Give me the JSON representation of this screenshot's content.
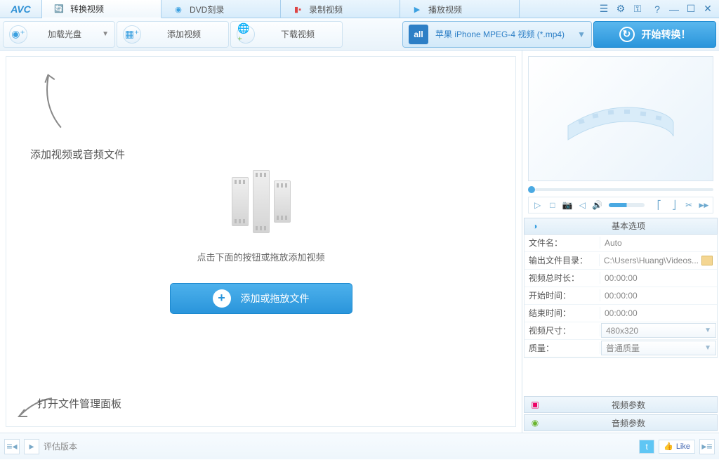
{
  "logo": "AVC",
  "tabs": [
    {
      "label": "转换视频",
      "icon": "🔄",
      "active": true
    },
    {
      "label": "DVD刻录",
      "icon": "◉",
      "active": false
    },
    {
      "label": "录制视频",
      "icon": "▮▪",
      "active": false
    },
    {
      "label": "播放视频",
      "icon": "▶",
      "active": false
    }
  ],
  "toolbar": {
    "load_disc": "加载光盘",
    "add_video": "添加视频",
    "download": "下载视频",
    "format": "苹果 iPhone MPEG-4 视频 (*.mp4)",
    "format_all": "all",
    "start": "开始转换！"
  },
  "hints": {
    "add_files": "添加视频或音频文件",
    "open_panel": "打开文件管理面板",
    "drop_text": "点击下面的按钮或拖放添加视频",
    "add_button": "添加或拖放文件"
  },
  "panels": {
    "basic": "基本选项",
    "video": "视频参数",
    "audio": "音频参数"
  },
  "props": {
    "filename_k": "文件名：",
    "filename_v": "Auto",
    "outdir_k": "输出文件目录：",
    "outdir_v": "C:\\Users\\Huang\\Videos...",
    "duration_k": "视频总时长：",
    "duration_v": "00:00:00",
    "start_k": "开始时间：",
    "start_v": "00:00:00",
    "end_k": "结束时间：",
    "end_v": "00:00:00",
    "size_k": "视频尺寸：",
    "size_v": "480x320",
    "quality_k": "质量：",
    "quality_v": "普通质量"
  },
  "status": {
    "text": "评估版本",
    "like": "Like"
  }
}
